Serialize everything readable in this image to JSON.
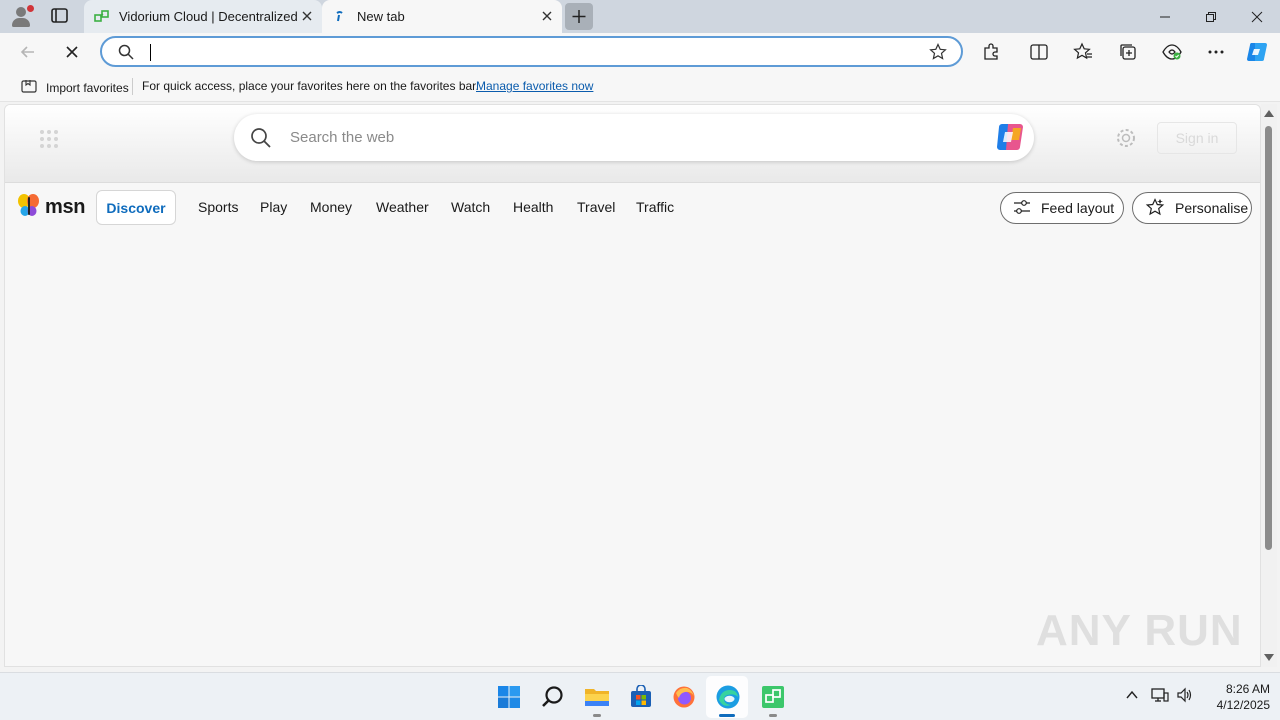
{
  "browser": {
    "tabs": [
      {
        "title": "Vidorium Cloud | Decentralized L",
        "favicon": "vidorium-icon"
      },
      {
        "title": "New tab",
        "favicon": "edge-loading-icon"
      }
    ],
    "address": {
      "value": "",
      "placeholder": ""
    }
  },
  "favorites_bar": {
    "import_label": "Import favorites",
    "message": "For quick access, place your favorites here on the favorites bar.",
    "link": "Manage favorites now"
  },
  "newtab": {
    "search_placeholder": "Search the web",
    "signin_label": "Sign in",
    "logo_text": "msn",
    "nav": [
      "Discover",
      "Sports",
      "Play",
      "Money",
      "Weather",
      "Watch",
      "Health",
      "Travel",
      "Traffic"
    ],
    "feed_layout_label": "Feed layout",
    "personalise_label": "Personalise"
  },
  "watermark": "ANY RUN",
  "taskbar": {
    "apps": [
      "start-icon",
      "search-icon",
      "file-explorer-icon",
      "store-icon",
      "firefox-icon",
      "edge-icon",
      "vidorium-icon"
    ],
    "time": "8:26 AM",
    "date": "4/12/2025"
  },
  "colors": {
    "accent": "#0f6cbd",
    "address_border": "#5e9bd6",
    "tabbar": "#cfd6df",
    "taskbar": "#edf1f5"
  }
}
